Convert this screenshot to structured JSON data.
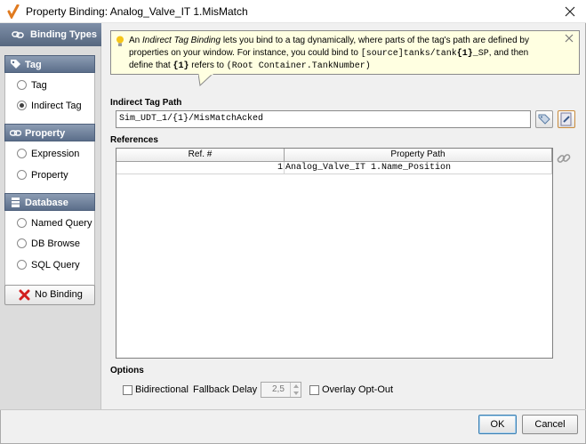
{
  "window": {
    "title": "Property Binding: Analog_Valve_IT 1.MisMatch"
  },
  "sidebar": {
    "title": "Binding Types",
    "groups": [
      {
        "title": "Tag",
        "options": [
          {
            "label": "Tag",
            "checked": false
          },
          {
            "label": "Indirect Tag",
            "checked": true
          }
        ]
      },
      {
        "title": "Property",
        "options": [
          {
            "label": "Expression",
            "checked": false
          },
          {
            "label": "Property",
            "checked": false
          }
        ]
      },
      {
        "title": "Database",
        "options": [
          {
            "label": "Named Query",
            "checked": false
          },
          {
            "label": "DB Browse",
            "checked": false
          },
          {
            "label": "SQL Query",
            "checked": false
          }
        ]
      }
    ],
    "no_binding_label": "No Binding"
  },
  "tip": {
    "l1a": "An ",
    "l1b": "Indirect Tag Binding",
    "l1c": " lets you bind to a tag dynamically, where parts of the tag's path are defined by",
    "l2a": "properties on your window. For instance, you could bind to ",
    "l2b": "[source]tanks/tank",
    "l2c": "{1}",
    "l2d": "_SP",
    "l2e": ", and then",
    "l3a": "define that ",
    "l3b": "{1}",
    "l3c": " refers to ",
    "l3d": "(Root Container.TankNumber)"
  },
  "indirect_path": {
    "label": "Indirect Tag Path",
    "value": "Sim_UDT_1/{1}/MisMatchAcked"
  },
  "references": {
    "label": "References",
    "columns": [
      "Ref. #",
      "Property Path"
    ],
    "rows": [
      {
        "ref": "1",
        "path": "Analog_Valve_IT 1.Name_Position"
      }
    ]
  },
  "options": {
    "label": "Options",
    "bidirectional": "Bidirectional",
    "fallback_label": "Fallback Delay",
    "fallback_value": "2,5",
    "overlay": "Overlay Opt-Out"
  },
  "buttons": {
    "ok": "OK",
    "cancel": "Cancel"
  },
  "colors": {
    "header_blue": "#5b6e8a",
    "tip_bg": "#ffffe1",
    "accent": "#3c7fb1"
  }
}
